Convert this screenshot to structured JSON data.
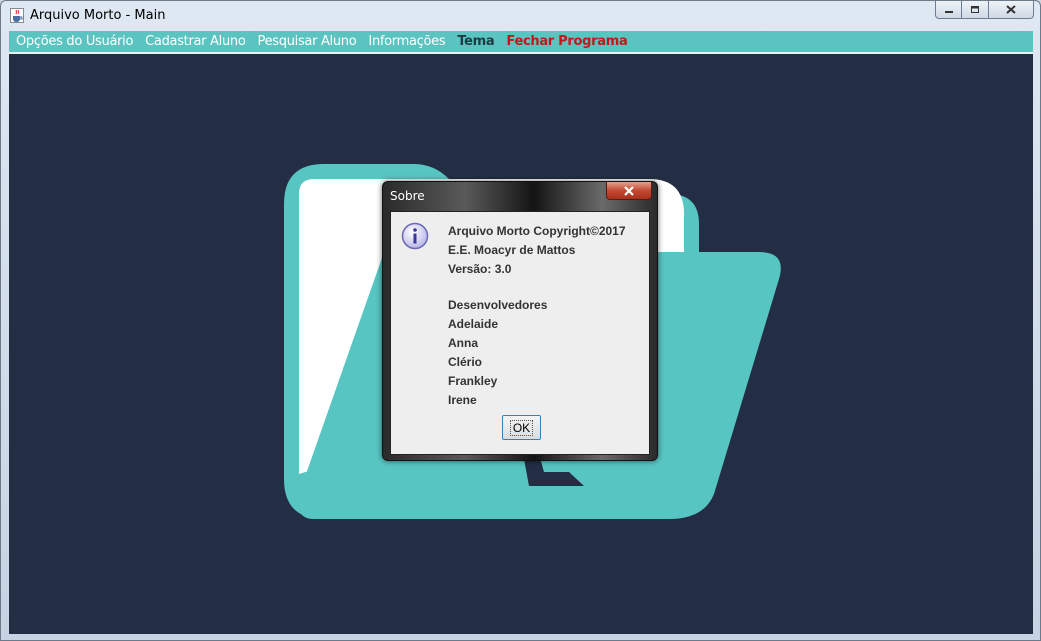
{
  "window": {
    "title": "Arquivo Morto - Main",
    "app_icon": "java-cup-icon"
  },
  "caption_buttons": {
    "minimize_icon": "minimize-icon",
    "maximize_icon": "maximize-icon",
    "close_icon": "close-icon"
  },
  "menu": {
    "items": [
      {
        "label": "Opções do Usuário"
      },
      {
        "label": "Cadastrar Aluno"
      },
      {
        "label": "Pesquisar Aluno"
      },
      {
        "label": "Informações"
      },
      {
        "label": "Tema"
      },
      {
        "label": "Fechar Programa"
      }
    ]
  },
  "background": {
    "logo_icon": "folder-logo-icon",
    "panel_color": "#232e44",
    "logo_color": "#57c5c2"
  },
  "dialog": {
    "title": "Sobre",
    "icon": "info-icon",
    "lines": [
      "Arquivo Morto Copyright©2017",
      "E.E. Moacyr de Mattos",
      "Versão: 3.0",
      "Desenvolvedores",
      "Adelaide",
      "Anna",
      "Clério",
      "Frankley",
      "Irene"
    ],
    "ok_label": "OK"
  },
  "colors": {
    "menubar": "#5bc4c0",
    "menu_text": "#ffffff",
    "menu_text_dark": "#1f3a45",
    "menu_text_red": "#c0181c"
  }
}
